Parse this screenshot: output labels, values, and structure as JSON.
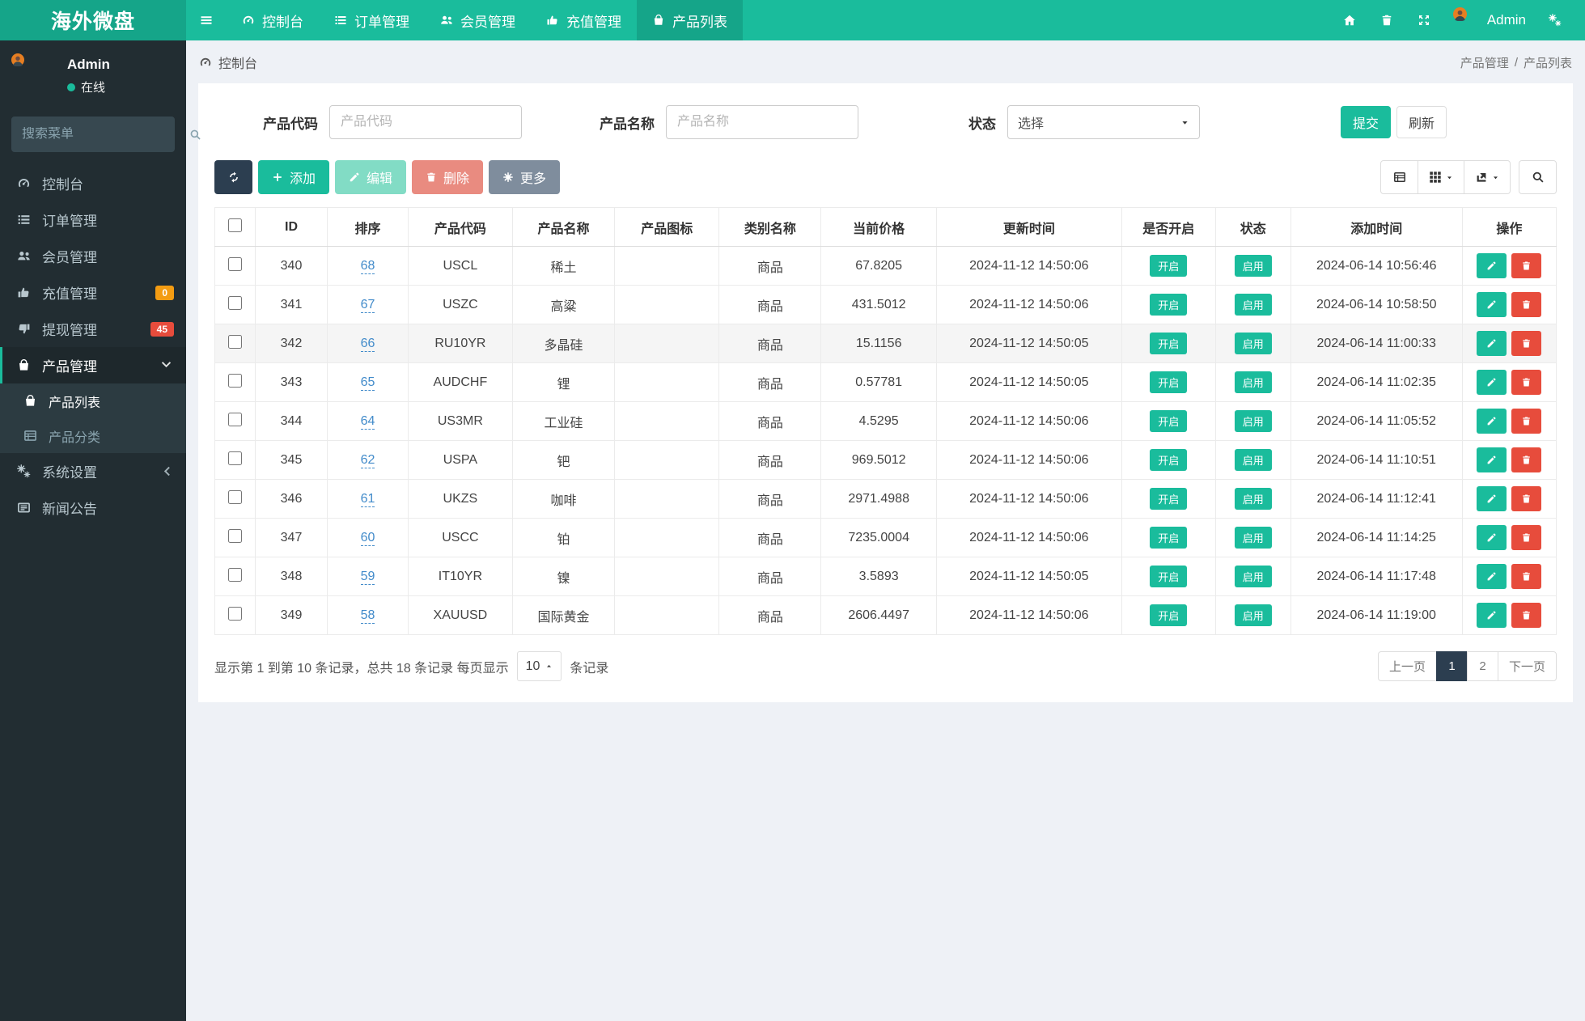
{
  "navbar": {
    "brand": "海外微盘",
    "items": [
      {
        "label": "控制台",
        "icon": "dashboard"
      },
      {
        "label": "订单管理",
        "icon": "list"
      },
      {
        "label": "会员管理",
        "icon": "users"
      },
      {
        "label": "充值管理",
        "icon": "hand-up"
      },
      {
        "label": "产品列表",
        "icon": "suitcase",
        "active": true
      }
    ],
    "user_name": "Admin"
  },
  "sidebar": {
    "user_name": "Admin",
    "user_status": "在线",
    "search_placeholder": "搜索菜单",
    "menu": [
      {
        "label": "控制台",
        "icon": "dashboard"
      },
      {
        "label": "订单管理",
        "icon": "list"
      },
      {
        "label": "会员管理",
        "icon": "users"
      },
      {
        "label": "充值管理",
        "icon": "hand-up",
        "badge": "0",
        "badge_color": "#f39c12"
      },
      {
        "label": "提现管理",
        "icon": "hand-down",
        "badge": "45",
        "badge_color": "#e74c3c"
      },
      {
        "label": "产品管理",
        "icon": "suitcase",
        "active": true,
        "chevron": "down",
        "children": [
          {
            "label": "产品列表",
            "icon": "suitcase",
            "active": true
          },
          {
            "label": "产品分类",
            "icon": "table-view"
          }
        ]
      },
      {
        "label": "系统设置",
        "icon": "cogs",
        "chevron": "left"
      },
      {
        "label": "新闻公告",
        "icon": "newspaper"
      }
    ]
  },
  "breadcrumb": {
    "left": "控制台",
    "right_parent": "产品管理",
    "right_sep": "/",
    "right_current": "产品列表"
  },
  "filters": {
    "code_label": "产品代码",
    "code_placeholder": "产品代码",
    "name_label": "产品名称",
    "name_placeholder": "产品名称",
    "status_label": "状态",
    "status_value": "选择",
    "submit_label": "提交",
    "refresh_label": "刷新"
  },
  "toolbar": {
    "add_label": "添加",
    "edit_label": "编辑",
    "delete_label": "删除",
    "more_label": "更多"
  },
  "table": {
    "columns": [
      "ID",
      "排序",
      "产品代码",
      "产品名称",
      "产品图标",
      "类别名称",
      "当前价格",
      "更新时间",
      "是否开启",
      "状态",
      "添加时间",
      "操作"
    ],
    "open_badge_label": "开启",
    "status_badge_label": "启用",
    "rows": [
      {
        "id": "340",
        "sort": "68",
        "code": "USCL",
        "name": "稀土",
        "category": "商品",
        "price": "67.8205",
        "updated": "2024-11-12 14:50:06",
        "added": "2024-06-14 10:56:46"
      },
      {
        "id": "341",
        "sort": "67",
        "code": "USZC",
        "name": "高粱",
        "category": "商品",
        "price": "431.5012",
        "updated": "2024-11-12 14:50:06",
        "added": "2024-06-14 10:58:50"
      },
      {
        "id": "342",
        "sort": "66",
        "code": "RU10YR",
        "name": "多晶硅",
        "category": "商品",
        "price": "15.1156",
        "updated": "2024-11-12 14:50:05",
        "added": "2024-06-14 11:00:33",
        "highlighted": true
      },
      {
        "id": "343",
        "sort": "65",
        "code": "AUDCHF",
        "name": "锂",
        "category": "商品",
        "price": "0.57781",
        "updated": "2024-11-12 14:50:05",
        "added": "2024-06-14 11:02:35"
      },
      {
        "id": "344",
        "sort": "64",
        "code": "US3MR",
        "name": "工业硅",
        "category": "商品",
        "price": "4.5295",
        "updated": "2024-11-12 14:50:06",
        "added": "2024-06-14 11:05:52"
      },
      {
        "id": "345",
        "sort": "62",
        "code": "USPA",
        "name": "钯",
        "category": "商品",
        "price": "969.5012",
        "updated": "2024-11-12 14:50:06",
        "added": "2024-06-14 11:10:51"
      },
      {
        "id": "346",
        "sort": "61",
        "code": "UKZS",
        "name": "咖啡",
        "category": "商品",
        "price": "2971.4988",
        "updated": "2024-11-12 14:50:06",
        "added": "2024-06-14 11:12:41"
      },
      {
        "id": "347",
        "sort": "60",
        "code": "USCC",
        "name": "铂",
        "category": "商品",
        "price": "7235.0004",
        "updated": "2024-11-12 14:50:06",
        "added": "2024-06-14 11:14:25"
      },
      {
        "id": "348",
        "sort": "59",
        "code": "IT10YR",
        "name": "镍",
        "category": "商品",
        "price": "3.5893",
        "updated": "2024-11-12 14:50:05",
        "added": "2024-06-14 11:17:48"
      },
      {
        "id": "349",
        "sort": "58",
        "code": "XAUUSD",
        "name": "国际黄金",
        "category": "商品",
        "price": "2606.4497",
        "updated": "2024-11-12 14:50:06",
        "added": "2024-06-14 11:19:00"
      }
    ]
  },
  "pagination": {
    "summary_prefix": "显示第 1 到第 10 条记录，总共 18 条记录 每页显示",
    "page_size": "10",
    "summary_suffix": "条记录",
    "prev_label": "上一页",
    "pages": [
      "1",
      "2"
    ],
    "active_page": "1",
    "next_label": "下一页"
  },
  "colors": {
    "accent": "#1abc9c",
    "accent_dark": "#15a589",
    "navy": "#2c3e50",
    "danger": "#e74c3c",
    "warning": "#f39c12",
    "salmon": "#e98b80",
    "gray_button": "#7f8d9d",
    "link": "#428bca",
    "sidebar_bg": "#222d32"
  }
}
